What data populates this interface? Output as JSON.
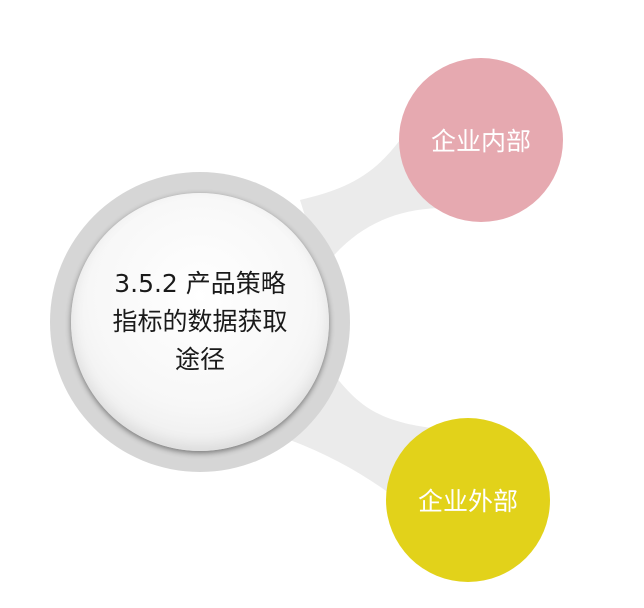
{
  "center": {
    "title": "3.5.2 产品策略指标的数据获取途径"
  },
  "nodes": [
    {
      "label": "企业内部",
      "color": "#e6a9b0"
    },
    {
      "label": "企业外部",
      "color": "#e2d21a"
    }
  ],
  "connector_color": "#ebebeb"
}
